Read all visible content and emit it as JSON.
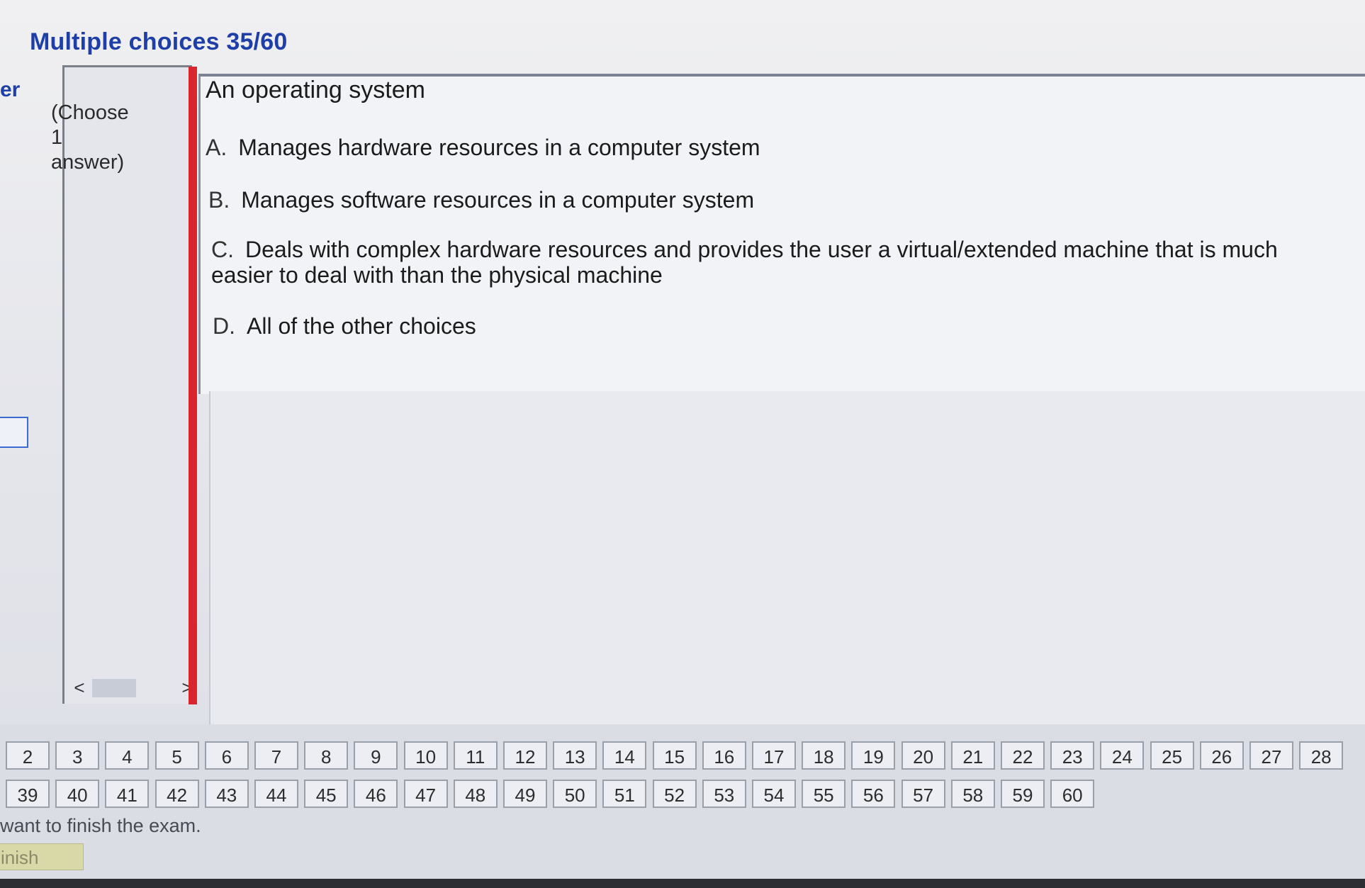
{
  "header": {
    "title": "Multiple choices 35/60"
  },
  "left_cut": {
    "text": "er"
  },
  "side": {
    "instruction": "(Choose\n1\nanswer)"
  },
  "scroll": {
    "left": "<",
    "right": ">"
  },
  "question": {
    "text": "An operating system",
    "options": [
      {
        "letter": "A.",
        "text": "Manages hardware resources in a computer system"
      },
      {
        "letter": "B.",
        "text": "Manages software resources in a computer system"
      },
      {
        "letter": "C.",
        "text": "Deals with complex hardware resources and provides the user a virtual/extended machine that is much easier to deal with than the physical machine"
      },
      {
        "letter": "D.",
        "text": "All of the other choices"
      }
    ]
  },
  "nav": {
    "row1": [
      "2",
      "3",
      "4",
      "5",
      "6",
      "7",
      "8",
      "9",
      "10",
      "11",
      "12",
      "13",
      "14",
      "15",
      "16",
      "17",
      "18",
      "19",
      "20",
      "21",
      "22",
      "23",
      "24",
      "25",
      "26",
      "27",
      "28"
    ],
    "row2": [
      "39",
      "40",
      "41",
      "42",
      "43",
      "44",
      "45",
      "46",
      "47",
      "48",
      "49",
      "50",
      "51",
      "52",
      "53",
      "54",
      "55",
      "56",
      "57",
      "58",
      "59",
      "60"
    ]
  },
  "footer": {
    "message": "want to finish the exam.",
    "finish_label": "inish"
  }
}
